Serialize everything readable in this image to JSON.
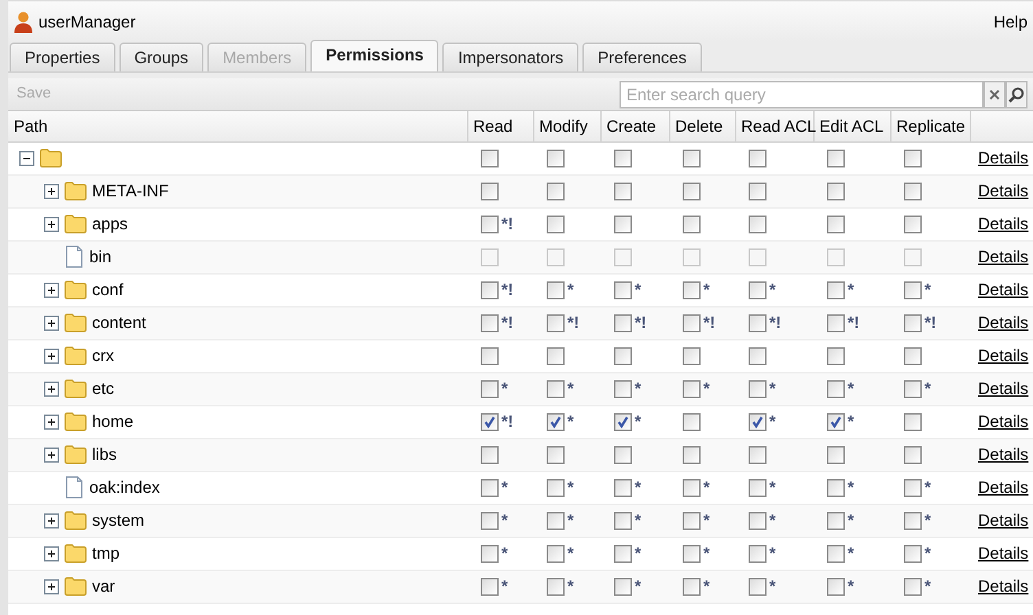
{
  "window": {
    "title": "userManager",
    "help": "Help"
  },
  "tabs": [
    {
      "label": "Properties",
      "selected": false,
      "disabled": false
    },
    {
      "label": "Groups",
      "selected": false,
      "disabled": false
    },
    {
      "label": "Members",
      "selected": false,
      "disabled": true
    },
    {
      "label": "Permissions",
      "selected": true,
      "disabled": false
    },
    {
      "label": "Impersonators",
      "selected": false,
      "disabled": false
    },
    {
      "label": "Preferences",
      "selected": false,
      "disabled": false
    }
  ],
  "toolbar": {
    "save": {
      "label": "Save",
      "disabled": true
    },
    "search": {
      "placeholder": "Enter search query"
    }
  },
  "table": {
    "columns": [
      "Path",
      "Read",
      "Modify",
      "Create",
      "Delete",
      "Read ACL",
      "Edit ACL",
      "Replicate"
    ],
    "tree": [
      {
        "kind": "folder",
        "expanded": true,
        "disabled": false,
        "action": "Details",
        "permissions": [
          {
            "checked": false
          },
          {
            "checked": false
          },
          {
            "checked": false
          },
          {
            "checked": false
          },
          {
            "checked": false
          },
          {
            "checked": false
          },
          {
            "checked": false
          }
        ],
        "children": [
          {
            "name": "META-INF",
            "kind": "folder",
            "expanded": false,
            "disabled": false,
            "action": "Details",
            "permissions": [
              {
                "checked": false
              },
              {
                "checked": false
              },
              {
                "checked": false
              },
              {
                "checked": false
              },
              {
                "checked": false
              },
              {
                "checked": false
              },
              {
                "checked": false
              }
            ]
          },
          {
            "name": "apps",
            "kind": "folder",
            "expanded": false,
            "disabled": false,
            "action": "Details",
            "permissions": [
              {
                "checked": false,
                "mark": "*!"
              },
              {
                "checked": false
              },
              {
                "checked": false
              },
              {
                "checked": false
              },
              {
                "checked": false
              },
              {
                "checked": false
              },
              {
                "checked": false
              }
            ]
          },
          {
            "name": "bin",
            "kind": "file",
            "disabled": true,
            "action": "Details",
            "permissions": [
              {
                "checked": false
              },
              {
                "checked": false
              },
              {
                "checked": false
              },
              {
                "checked": false
              },
              {
                "checked": false
              },
              {
                "checked": false
              },
              {
                "checked": false
              }
            ]
          },
          {
            "name": "conf",
            "kind": "folder",
            "expanded": false,
            "disabled": false,
            "action": "Details",
            "permissions": [
              {
                "checked": false,
                "mark": "*!"
              },
              {
                "checked": false,
                "mark": "*"
              },
              {
                "checked": false,
                "mark": "*"
              },
              {
                "checked": false,
                "mark": "*"
              },
              {
                "checked": false,
                "mark": "*"
              },
              {
                "checked": false,
                "mark": "*"
              },
              {
                "checked": false,
                "mark": "*"
              }
            ]
          },
          {
            "name": "content",
            "kind": "folder",
            "expanded": false,
            "disabled": false,
            "action": "Details",
            "permissions": [
              {
                "checked": false,
                "mark": "*!"
              },
              {
                "checked": false,
                "mark": "*!"
              },
              {
                "checked": false,
                "mark": "*!"
              },
              {
                "checked": false,
                "mark": "*!"
              },
              {
                "checked": false,
                "mark": "*!"
              },
              {
                "checked": false,
                "mark": "*!"
              },
              {
                "checked": false,
                "mark": "*!"
              }
            ]
          },
          {
            "name": "crx",
            "kind": "folder",
            "expanded": false,
            "disabled": false,
            "action": "Details",
            "permissions": [
              {
                "checked": false
              },
              {
                "checked": false
              },
              {
                "checked": false
              },
              {
                "checked": false
              },
              {
                "checked": false
              },
              {
                "checked": false
              },
              {
                "checked": false
              }
            ]
          },
          {
            "name": "etc",
            "kind": "folder",
            "expanded": false,
            "disabled": false,
            "action": "Details",
            "permissions": [
              {
                "checked": false,
                "mark": "*"
              },
              {
                "checked": false,
                "mark": "*"
              },
              {
                "checked": false,
                "mark": "*"
              },
              {
                "checked": false,
                "mark": "*"
              },
              {
                "checked": false,
                "mark": "*"
              },
              {
                "checked": false,
                "mark": "*"
              },
              {
                "checked": false,
                "mark": "*"
              }
            ]
          },
          {
            "name": "home",
            "kind": "folder",
            "expanded": false,
            "disabled": false,
            "action": "Details",
            "permissions": [
              {
                "checked": true,
                "mark": "*!"
              },
              {
                "checked": true,
                "mark": "*"
              },
              {
                "checked": true,
                "mark": "*"
              },
              {
                "checked": false
              },
              {
                "checked": true,
                "mark": "*"
              },
              {
                "checked": true,
                "mark": "*"
              },
              {
                "checked": false
              }
            ]
          },
          {
            "name": "libs",
            "kind": "folder",
            "expanded": false,
            "disabled": false,
            "action": "Details",
            "permissions": [
              {
                "checked": false
              },
              {
                "checked": false
              },
              {
                "checked": false
              },
              {
                "checked": false
              },
              {
                "checked": false
              },
              {
                "checked": false
              },
              {
                "checked": false
              }
            ]
          },
          {
            "name": "oak:index",
            "kind": "file",
            "disabled": false,
            "action": "Details",
            "permissions": [
              {
                "checked": false,
                "mark": "*"
              },
              {
                "checked": false,
                "mark": "*"
              },
              {
                "checked": false,
                "mark": "*"
              },
              {
                "checked": false,
                "mark": "*"
              },
              {
                "checked": false,
                "mark": "*"
              },
              {
                "checked": false,
                "mark": "*"
              },
              {
                "checked": false,
                "mark": "*"
              }
            ]
          },
          {
            "name": "system",
            "kind": "folder",
            "expanded": false,
            "disabled": false,
            "action": "Details",
            "permissions": [
              {
                "checked": false,
                "mark": "*"
              },
              {
                "checked": false,
                "mark": "*"
              },
              {
                "checked": false,
                "mark": "*"
              },
              {
                "checked": false,
                "mark": "*"
              },
              {
                "checked": false,
                "mark": "*"
              },
              {
                "checked": false,
                "mark": "*"
              },
              {
                "checked": false,
                "mark": "*"
              }
            ]
          },
          {
            "name": "tmp",
            "kind": "folder",
            "expanded": false,
            "disabled": false,
            "action": "Details",
            "permissions": [
              {
                "checked": false,
                "mark": "*"
              },
              {
                "checked": false,
                "mark": "*"
              },
              {
                "checked": false,
                "mark": "*"
              },
              {
                "checked": false,
                "mark": "*"
              },
              {
                "checked": false,
                "mark": "*"
              },
              {
                "checked": false,
                "mark": "*"
              },
              {
                "checked": false,
                "mark": "*"
              }
            ]
          },
          {
            "name": "var",
            "kind": "folder",
            "expanded": false,
            "disabled": false,
            "action": "Details",
            "permissions": [
              {
                "checked": false,
                "mark": "*"
              },
              {
                "checked": false,
                "mark": "*"
              },
              {
                "checked": false,
                "mark": "*"
              },
              {
                "checked": false,
                "mark": "*"
              },
              {
                "checked": false,
                "mark": "*"
              },
              {
                "checked": false,
                "mark": "*"
              },
              {
                "checked": false,
                "mark": "*"
              }
            ]
          }
        ]
      }
    ]
  }
}
